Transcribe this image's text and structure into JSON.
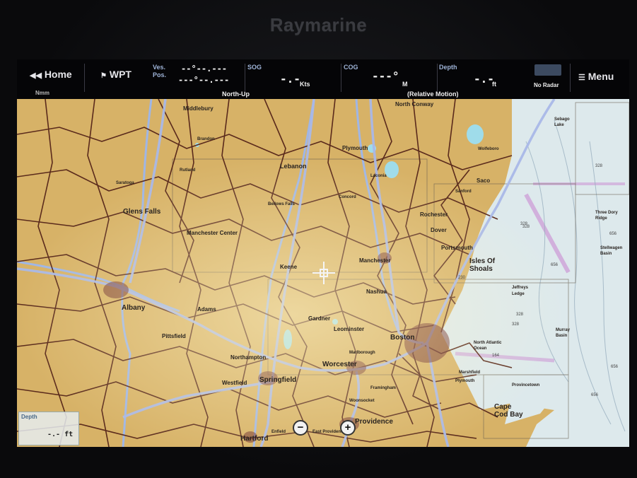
{
  "brand": "Raymarine",
  "databar": {
    "home_label": "Home",
    "home_sub": "Nmm",
    "wpt_label": "WPT",
    "ves_pos_label": "Ves.\nPos.",
    "pos_line1": "--°--.---",
    "pos_line2": "---°--.---",
    "orientation": "North-Up",
    "sog_label": "SOG",
    "sog_value": "-.-",
    "sog_unit": "Kts",
    "cog_label": "COG",
    "cog_value": "---°",
    "cog_unit": "M",
    "motion_mode": "(Relative Motion)",
    "depth_label": "Depth",
    "depth_value": "-.-",
    "depth_unit": "ft",
    "radar_status": "No Radar",
    "menu_label": "Menu"
  },
  "depth_widget": {
    "label": "Depth",
    "value": "-.- ft"
  },
  "map": {
    "places": [
      "Middlebury",
      "North Conway",
      "Lebanon",
      "Plymouth",
      "Glens Falls",
      "Manchester Center",
      "Rochester",
      "Dover",
      "Portsmouth",
      "Isles Of",
      "Shoals",
      "Keene",
      "Manchester",
      "Nashua",
      "Albany",
      "Adams",
      "Pittsfield",
      "Gardner",
      "Leominster",
      "Boston",
      "Worcester",
      "Springfield",
      "Northampton",
      "Westfield",
      "Providence",
      "Hartford",
      "Cape",
      "Cod Bay",
      "Provincetown",
      "Three Dory",
      "Ridge",
      "Stellwagen",
      "Basin",
      "Murray",
      "Basin",
      "Jeffreys",
      "Ledge",
      "Sebago",
      "Lake",
      "Saratoga",
      "Rutland",
      "Brandon",
      "Bellows Falls",
      "Concord",
      "Laconia",
      "Marlborough",
      "Framingham",
      "Woonsocket",
      "East Providence",
      "Enfield",
      "Plymouth",
      "North Atlantic",
      "Ocean",
      "Marshfield",
      "Wolfeboro",
      "Sanford",
      "Saco"
    ],
    "soundings": [
      "328",
      "328",
      "656",
      "328",
      "328",
      "656",
      "230",
      "328",
      "656",
      "164",
      "656"
    ],
    "zoom_out": "−",
    "zoom_in": "+"
  },
  "colors": {
    "land": "#d7b267",
    "water": "#dde9ec",
    "roads": "#5a2a1c",
    "rivers": "#9fb6e6"
  }
}
